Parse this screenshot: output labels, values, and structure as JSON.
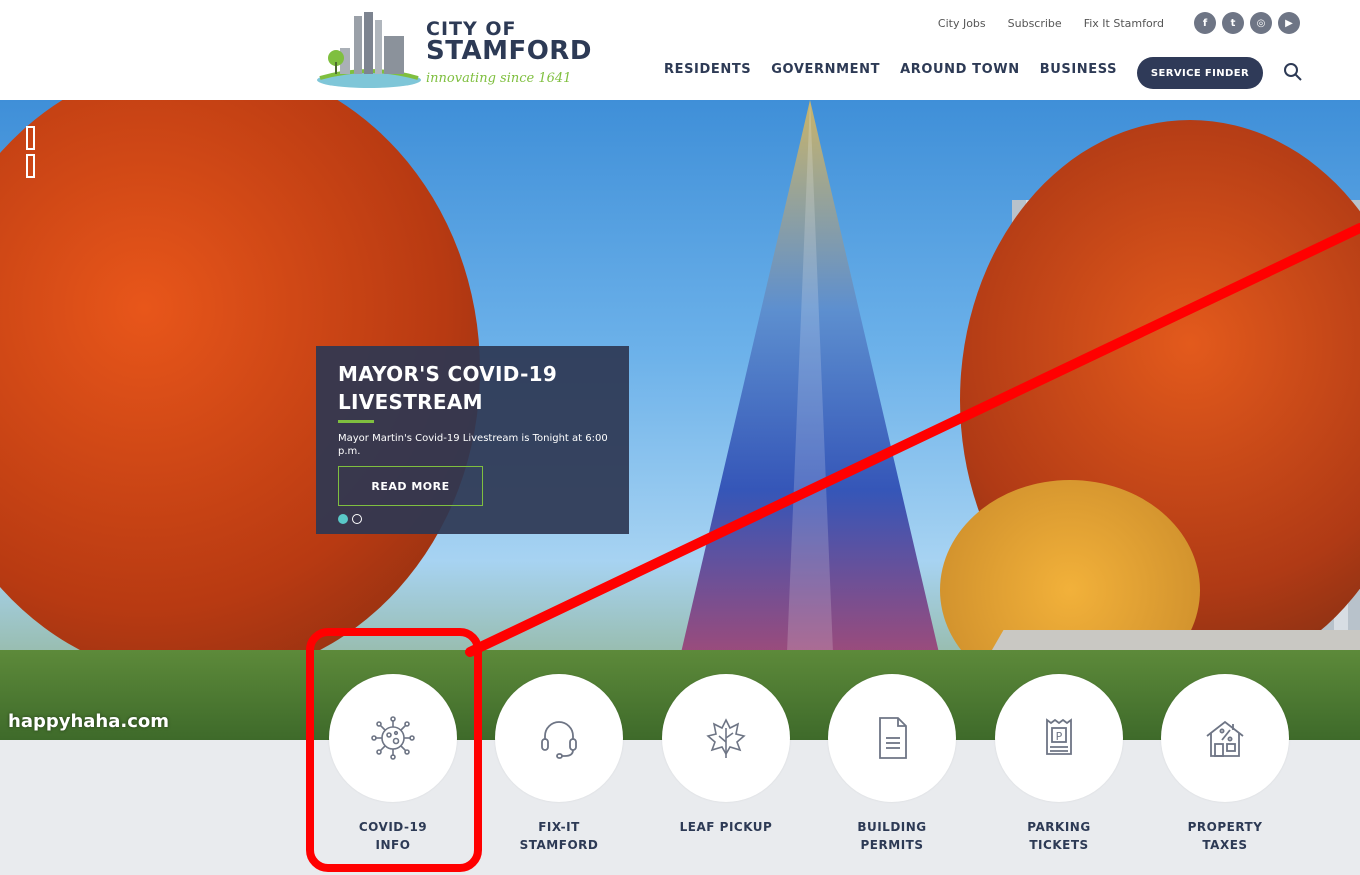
{
  "header": {
    "logo_city": "CITY OF",
    "logo_name": "STAMFORD",
    "logo_tagline": "innovating since 1641",
    "utility_links": [
      "City Jobs",
      "Subscribe",
      "Fix It Stamford"
    ],
    "social_icons": [
      "facebook-icon",
      "twitter-icon",
      "instagram-icon",
      "youtube-icon"
    ],
    "nav": [
      "RESIDENTS",
      "GOVERNMENT",
      "AROUND TOWN",
      "BUSINESS"
    ],
    "service_finder": "SERVICE FINDER"
  },
  "hero": {
    "watermark": "happyhaha.com",
    "slide": {
      "title": "MAYOR'S COVID-19 LIVESTREAM",
      "text": "Mayor Martin's Covid-19 Livestream is Tonight at 6:00 p.m.",
      "cta": "READ MORE",
      "slides_total": 2,
      "slide_active": 1
    }
  },
  "quick_links": [
    {
      "line1": "COVID-19",
      "line2": "INFO",
      "icon": "virus-icon"
    },
    {
      "line1": "FIX-IT",
      "line2": "STAMFORD",
      "icon": "headset-icon"
    },
    {
      "line1": "LEAF PICKUP",
      "line2": "",
      "icon": "leaf-icon"
    },
    {
      "line1": "BUILDING",
      "line2": "PERMITS",
      "icon": "document-icon"
    },
    {
      "line1": "PARKING",
      "line2": "TICKETS",
      "icon": "parking-ticket-icon"
    },
    {
      "line1": "PROPERTY",
      "line2": "TAXES",
      "icon": "house-tax-icon"
    }
  ],
  "colors": {
    "navy": "#2d3a55",
    "accent_green": "#7fbf3f",
    "annotation_red": "#ff0000"
  }
}
